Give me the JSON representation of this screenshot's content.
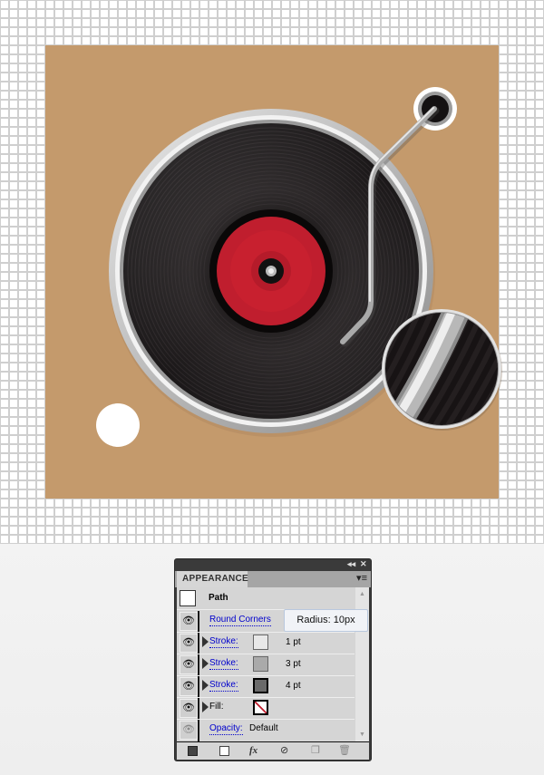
{
  "canvas": {
    "background_color": "#c49a6c",
    "grid_color": "#cfcfcf",
    "label_color": "#c01e2e",
    "vinyl_color": "#141112",
    "plate_color": "#f0f0f0"
  },
  "panel": {
    "title": "APPEARANCE",
    "collapse_glyph": "◂◂",
    "close_glyph": "✕",
    "menu_glyph": "▾≡",
    "object_type": "Path",
    "rows": [
      {
        "label": "Round Corners",
        "kind": "effect"
      },
      {
        "label": "Stroke:",
        "kind": "stroke",
        "swatch": "#e8e8e8",
        "value": "1 pt"
      },
      {
        "label": "Stroke:",
        "kind": "stroke",
        "swatch": "#aaaaaa",
        "value": "3 pt"
      },
      {
        "label": "Stroke:",
        "kind": "stroke",
        "swatch": "#6a6a6a",
        "value": "4 pt"
      },
      {
        "label": "Fill:",
        "kind": "fill",
        "swatch": "none"
      },
      {
        "label": "Opacity:",
        "kind": "opacity",
        "value": "Default"
      }
    ],
    "footer_icons": [
      "new-stroke-icon",
      "new-fill-icon",
      "fx-icon",
      "clear-icon",
      "duplicate-icon",
      "delete-icon"
    ],
    "fx_label": "fx"
  },
  "tooltip": {
    "text": "Radius: 10px"
  }
}
